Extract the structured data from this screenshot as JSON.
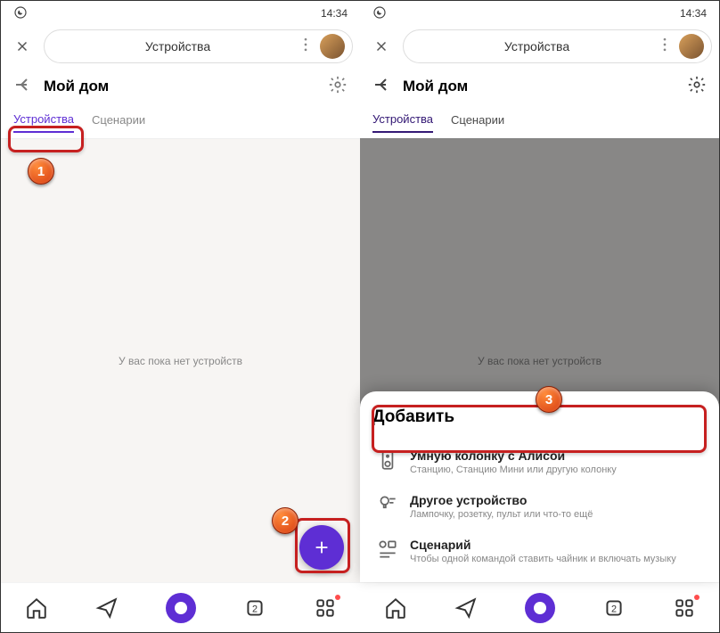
{
  "status": {
    "time": "14:34"
  },
  "search": {
    "label": "Устройства"
  },
  "header": {
    "title": "Мой дом"
  },
  "tabs": {
    "devices": "Устройства",
    "scenarios": "Сценарии"
  },
  "empty": {
    "message": "У вас пока нет устройств"
  },
  "nav": {
    "count": "2"
  },
  "sheet": {
    "title": "Добавить",
    "items": [
      {
        "title": "Умную колонку с Алисой",
        "subtitle": "Станцию, Станцию Мини или другую колонку"
      },
      {
        "title": "Другое устройство",
        "subtitle": "Лампочку, розетку, пульт или что-то ещё"
      },
      {
        "title": "Сценарий",
        "subtitle": "Чтобы одной командой ставить чайник и включать музыку"
      }
    ]
  },
  "badges": {
    "1": "1",
    "2": "2",
    "3": "3"
  }
}
